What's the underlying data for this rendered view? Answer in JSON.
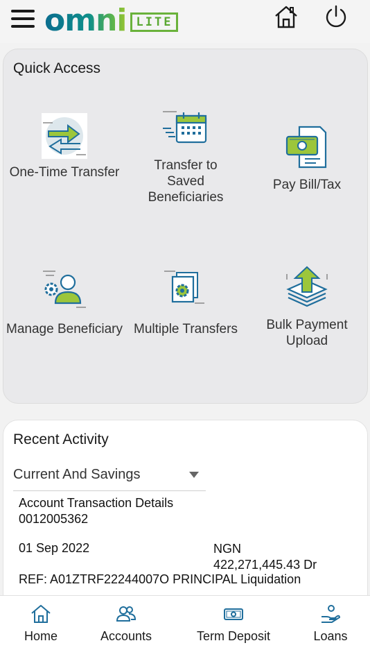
{
  "header": {
    "brand_name": "omni",
    "brand_badge": "LITE"
  },
  "quick_access": {
    "title": "Quick Access",
    "items": [
      {
        "label": "One-Time Transfer",
        "icon": "transfer-arrows-icon"
      },
      {
        "label": "Transfer to Saved Beneficiaries",
        "icon": "calendar-transfer-icon"
      },
      {
        "label": "Pay Bill/Tax",
        "icon": "bill-icon"
      },
      {
        "label": "Manage Beneficiary",
        "icon": "user-gear-icon"
      },
      {
        "label": "Multiple Transfers",
        "icon": "document-gear-icon"
      },
      {
        "label": "Bulk Payment Upload",
        "icon": "upload-stack-icon"
      }
    ]
  },
  "recent_activity": {
    "title": "Recent Activity",
    "account_type": "Current And Savings",
    "details_label": "Account Transaction Details",
    "account_number": "0012005362",
    "date": "01 Sep 2022",
    "currency": "NGN",
    "amount": "422,271,445.43 Dr",
    "reference": "REF: A01ZTRF22244007O PRINCIPAL Liquidation"
  },
  "bottom_nav": {
    "items": [
      {
        "label": "Home",
        "icon": "home-icon"
      },
      {
        "label": "Accounts",
        "icon": "accounts-icon"
      },
      {
        "label": "Term Deposit",
        "icon": "term-deposit-icon"
      },
      {
        "label": "Loans",
        "icon": "loans-icon"
      }
    ]
  },
  "colors": {
    "brand_blue": "#0b6d8f",
    "brand_green": "#6ab23b",
    "icon_blue": "#1f6e9c",
    "card_bg": "#e9e9eb"
  }
}
